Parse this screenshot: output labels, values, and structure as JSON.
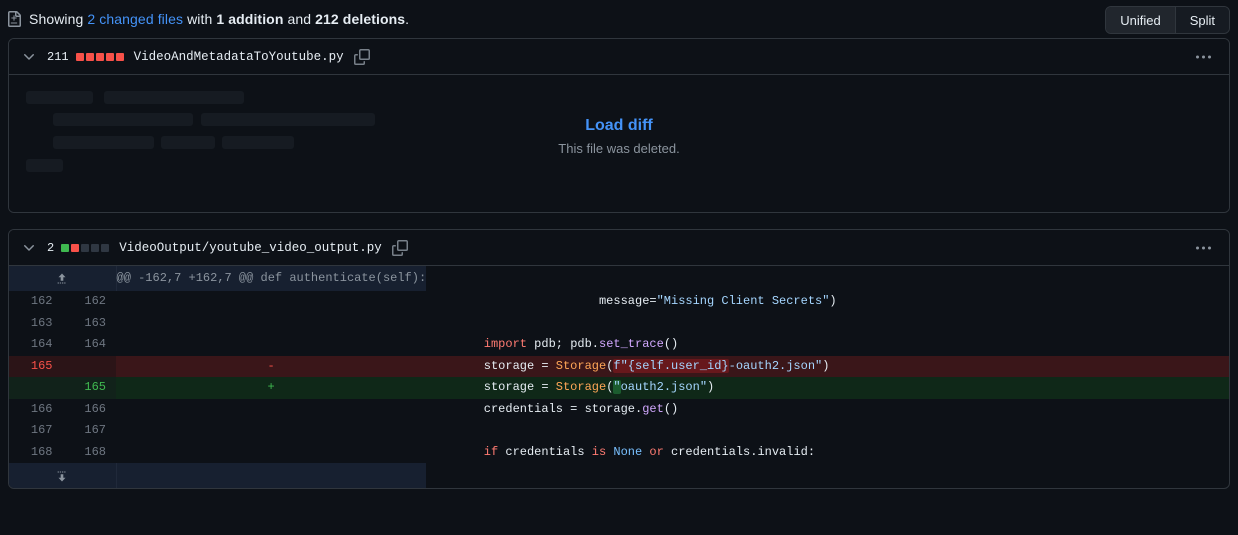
{
  "summary": {
    "icon": "file-diff-icon",
    "prefix": "Showing ",
    "changed_files_link": "2 changed files",
    "mid": " with ",
    "additions": "1 addition",
    "and": " and ",
    "deletions": "212 deletions",
    "suffix": "."
  },
  "view_toggle": {
    "unified_label": "Unified",
    "split_label": "Split"
  },
  "files": [
    {
      "change_count": "211",
      "path": "VideoAndMetadataToYoutube.py",
      "diffstat": [
        "del",
        "del",
        "del",
        "del",
        "del"
      ],
      "state": "deleted",
      "load_diff_label": "Load diff",
      "load_note": "This file was deleted."
    },
    {
      "change_count": "2",
      "path": "VideoOutput/youtube_video_output.py",
      "diffstat": [
        "add",
        "del",
        "none",
        "none",
        "none"
      ],
      "state": "expanded",
      "hunk_header": "@@ -162,7 +162,7 @@ def authenticate(self):",
      "rows": [
        {
          "type": "context",
          "old": "162",
          "new": "162",
          "marker": "",
          "tokens": [
            {
              "t": "                        ",
              "c": "plain"
            },
            {
              "t": "message=",
              "c": "plain"
            },
            {
              "t": "\"Missing Client Secrets\"",
              "c": "str"
            },
            {
              "t": ")",
              "c": "plain"
            }
          ]
        },
        {
          "type": "context",
          "old": "163",
          "new": "163",
          "marker": "",
          "tokens": []
        },
        {
          "type": "context",
          "old": "164",
          "new": "164",
          "marker": "",
          "tokens": [
            {
              "t": "        ",
              "c": "plain"
            },
            {
              "t": "import",
              "c": "kw"
            },
            {
              "t": " pdb; pdb.",
              "c": "plain"
            },
            {
              "t": "set_trace",
              "c": "fn"
            },
            {
              "t": "()",
              "c": "plain"
            }
          ]
        },
        {
          "type": "deletion",
          "old": "165",
          "new": "",
          "marker": "-",
          "tokens": [
            {
              "t": "        storage = ",
              "c": "plain"
            },
            {
              "t": "Storage",
              "c": "cls"
            },
            {
              "t": "(",
              "c": "plain"
            },
            {
              "t": "f\"{self.user_id}",
              "c": "str",
              "hl": "del"
            },
            {
              "t": "-oauth2.json\"",
              "c": "str"
            },
            {
              "t": ")",
              "c": "plain"
            }
          ]
        },
        {
          "type": "addition",
          "old": "",
          "new": "165",
          "marker": "+",
          "tokens": [
            {
              "t": "        storage = ",
              "c": "plain"
            },
            {
              "t": "Storage",
              "c": "cls"
            },
            {
              "t": "(",
              "c": "plain"
            },
            {
              "t": "\"",
              "c": "str",
              "hl": "add"
            },
            {
              "t": "oauth2.json\"",
              "c": "str"
            },
            {
              "t": ")",
              "c": "plain"
            }
          ]
        },
        {
          "type": "context",
          "old": "166",
          "new": "166",
          "marker": "",
          "tokens": [
            {
              "t": "        credentials = storage.",
              "c": "plain"
            },
            {
              "t": "get",
              "c": "fn"
            },
            {
              "t": "()",
              "c": "plain"
            }
          ]
        },
        {
          "type": "context",
          "old": "167",
          "new": "167",
          "marker": "",
          "tokens": []
        },
        {
          "type": "context",
          "old": "168",
          "new": "168",
          "marker": "",
          "tokens": [
            {
              "t": "        ",
              "c": "plain"
            },
            {
              "t": "if",
              "c": "kw"
            },
            {
              "t": " credentials ",
              "c": "plain"
            },
            {
              "t": "is",
              "c": "kw"
            },
            {
              "t": " ",
              "c": "plain"
            },
            {
              "t": "None",
              "c": "const"
            },
            {
              "t": " ",
              "c": "plain"
            },
            {
              "t": "or",
              "c": "kw"
            },
            {
              "t": " credentials.invalid:",
              "c": "plain"
            }
          ]
        }
      ]
    }
  ],
  "colors": {
    "accent_link": "#4493f8",
    "addition": "#3fb950",
    "deletion": "#f85149",
    "background": "#0d1117",
    "border": "#30363d"
  }
}
